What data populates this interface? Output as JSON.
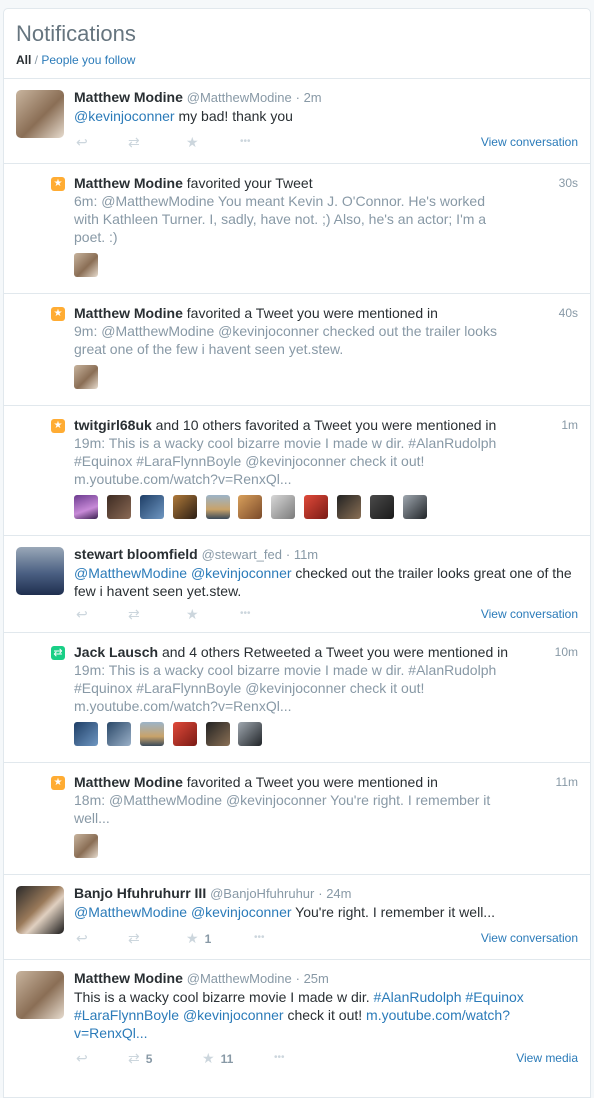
{
  "header": {
    "title": "Notifications",
    "filter_all": "All",
    "filter_sep": " / ",
    "filter_following": "People you follow"
  },
  "items": [
    {
      "type": "tweet",
      "name": "Matthew Modine",
      "handle": "@MatthewModine",
      "time": "· 2m",
      "mention": "@kevinjoconner",
      "text": " my bad! thank you",
      "view": "View conversation"
    },
    {
      "type": "fav",
      "name": "Matthew Modine",
      "action": " favorited your Tweet",
      "time": "30s",
      "q_line1": "6m: @MatthewModine  You meant Kevin J. O'Connor. He's worked",
      "q_line2": "with Kathleen Turner. I, sadly, have not. ;) Also, he's an actor; I'm a",
      "q_line3": "poet. :)"
    },
    {
      "type": "fav",
      "name": "Matthew Modine",
      "action": " favorited a Tweet you were mentioned in",
      "time": "40s",
      "q_line1": "9m: @MatthewModine @kevinjoconner checked out the trailer looks",
      "q_line2": "great one of the few i havent seen yet.stew."
    },
    {
      "type": "fav",
      "name": "twitgirl68uk",
      "action": " and 10 others favorited a Tweet you were mentioned in",
      "time": "1m",
      "q_line1": "19m: This is a wacky cool bizarre movie I made w dir. #AlanRudolph",
      "q_line2": "#Equinox #LaraFlynnBoyle @kevinjoconner check it out!",
      "q_line3": "m.youtube.com/watch?v=RenxQl..."
    },
    {
      "type": "tweet",
      "name": "stewart bloomfield",
      "handle": "@stewart_fed",
      "time": "· 11m",
      "m1": "@MatthewModine",
      "m2": "@kevinjoconner",
      "text1": " checked out the trailer looks great one of the",
      "text2": "few i havent seen yet.stew.",
      "view": "View conversation"
    },
    {
      "type": "rt",
      "name": "Jack Lausch",
      "action": " and 4 others Retweeted a Tweet you were mentioned in",
      "time": "10m",
      "q_line1": "19m: This is a wacky cool bizarre movie I made w dir. #AlanRudolph",
      "q_line2": "#Equinox #LaraFlynnBoyle @kevinjoconner check it out!",
      "q_line3": "m.youtube.com/watch?v=RenxQl..."
    },
    {
      "type": "fav",
      "name": "Matthew Modine",
      "action": " favorited a Tweet you were mentioned in",
      "time": "11m",
      "q_line1": "18m: @MatthewModine @kevinjoconner You're right. I remember it",
      "q_line2": "well..."
    },
    {
      "type": "tweet",
      "name": "Banjo Hfuhruhurr III",
      "handle": "@BanjoHfuhruhur",
      "time": "· 24m",
      "m1": "@MatthewModine",
      "m2": "@kevinjoconner",
      "text": " You're right. I remember it well...",
      "fav_count": "1",
      "view": "View conversation"
    },
    {
      "type": "tweet",
      "name": "Matthew Modine",
      "handle": "@MatthewModine",
      "time": "· 25m",
      "text1": "This is a wacky cool bizarre movie I made w dir. ",
      "h1": "#AlanRudolph",
      "h2": "#Equinox",
      "h3": "#LaraFlynnBoyle",
      "m2": "@kevinjoconner",
      "text2": " check it out! ",
      "url1": "m.youtube.com/watch?",
      "url2": "v=RenxQl...",
      "rt_count": "5",
      "fav_count": "11",
      "view": "View media"
    }
  ],
  "icons": {
    "reply": "↩",
    "retweet": "⇄",
    "favorite": "★",
    "more": "•••",
    "star_badge": "★",
    "rt_badge": "⇄"
  },
  "colors": {
    "link": "#2b7bb9",
    "muted": "#8899a6",
    "fav": "#ffac33",
    "rt": "#19cf86"
  }
}
